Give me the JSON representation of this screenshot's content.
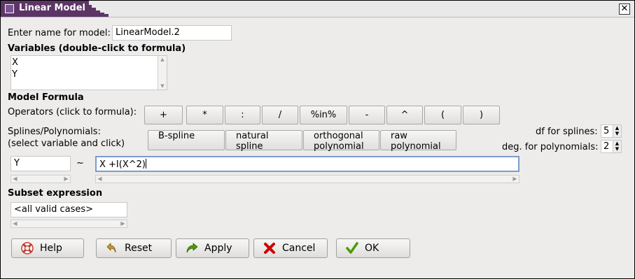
{
  "window": {
    "title": "Linear Model",
    "close_icon": "close-icon"
  },
  "model_name": {
    "label": "Enter name for model:",
    "value": "LinearModel.2"
  },
  "variables": {
    "heading": "Variables (double-click to formula)",
    "items": [
      "X",
      "Y"
    ]
  },
  "formula": {
    "heading": "Model Formula",
    "operators_label": "Operators (click to formula):",
    "operators": [
      "+",
      "*",
      ":",
      "/",
      "%in%",
      "-",
      "^",
      "(",
      ")"
    ],
    "splines_label_1": "Splines/Polynomials:",
    "splines_label_2": "(select variable and click)",
    "spline_buttons": [
      {
        "line1": "B-spline",
        "line2": ""
      },
      {
        "line1": "natural",
        "line2": "spline"
      },
      {
        "line1": "orthogonal",
        "line2": "polynomial"
      },
      {
        "line1": "raw",
        "line2": "polynomial"
      }
    ],
    "df_label": "df for splines:",
    "df_value": "5",
    "deg_label": "deg. for polynomials:",
    "deg_value": "2",
    "lhs": "Y",
    "tilde": "~",
    "rhs": "X +I(X^2)"
  },
  "subset": {
    "heading": "Subset expression",
    "value": "<all valid cases>"
  },
  "buttons": {
    "help": "Help",
    "reset": "Reset",
    "apply": "Apply",
    "cancel": "Cancel",
    "ok": "OK"
  }
}
